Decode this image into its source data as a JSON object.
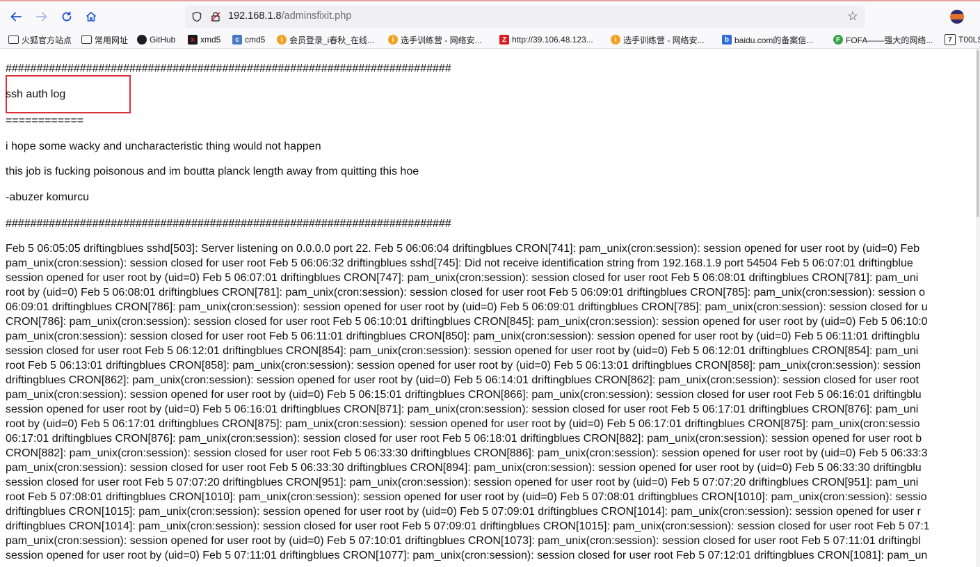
{
  "browser": {
    "url_host": "192.168.1.8",
    "url_path": "/adminsfixit.php"
  },
  "bookmarks": [
    {
      "label": "火狐官方站点",
      "icon": "folder-icon"
    },
    {
      "label": "常用网址",
      "icon": "folder-icon"
    },
    {
      "label": "GitHub",
      "icon": "github-icon"
    },
    {
      "label": "xmd5",
      "icon": "xmd5-icon"
    },
    {
      "label": "cmd5",
      "icon": "cmd5-icon"
    },
    {
      "label": "会员登录_i春秋_在线...",
      "icon": "ichunqiu-icon"
    },
    {
      "label": "选手训练营 - 网络安...",
      "icon": "ichunqiu-icon"
    },
    {
      "label": "http://39.106.48.123...",
      "icon": "z-icon"
    },
    {
      "label": "选手训练营 - 网络安...",
      "icon": "ichunqiu-icon"
    },
    {
      "label": "baidu.com的备案信...",
      "icon": "baidu-icon"
    },
    {
      "label": "FOFA——强大的网络...",
      "icon": "fofa-icon"
    },
    {
      "label": "T00LS",
      "icon": "tools-icon"
    }
  ],
  "page": {
    "hash_line_1": "########################################################################",
    "heading": "ssh auth log",
    "equals_line": "============",
    "message_1": "i hope some wacky and uncharacteristic thing would not happen",
    "message_2": "this job is fucking poisonous and im boutta planck length away from quitting this hoe",
    "signature": "-abuzer komurcu",
    "hash_line_2": "########################################################################",
    "log_lines": [
      "Feb 5 06:05:05 driftingblues sshd[503]: Server listening on 0.0.0.0 port 22. Feb 5 06:06:04 driftingblues CRON[741]: pam_unix(cron:session): session opened for user root by (uid=0) Feb",
      "pam_unix(cron:session): session closed for user root Feb 5 06:06:32 driftingblues sshd[745]: Did not receive identification string from 192.168.1.9 port 54504 Feb 5 06:07:01 driftingblue",
      "session opened for user root by (uid=0) Feb 5 06:07:01 driftingblues CRON[747]: pam_unix(cron:session): session closed for user root Feb 5 06:08:01 driftingblues CRON[781]: pam_uni",
      "root by (uid=0) Feb 5 06:08:01 driftingblues CRON[781]: pam_unix(cron:session): session closed for user root Feb 5 06:09:01 driftingblues CRON[785]: pam_unix(cron:session): session o",
      "06:09:01 driftingblues CRON[786]: pam_unix(cron:session): session opened for user root by (uid=0) Feb 5 06:09:01 driftingblues CRON[785]: pam_unix(cron:session): session closed for u",
      "CRON[786]: pam_unix(cron:session): session closed for user root Feb 5 06:10:01 driftingblues CRON[845]: pam_unix(cron:session): session opened for user root by (uid=0) Feb 5 06:10:0",
      "pam_unix(cron:session): session closed for user root Feb 5 06:11:01 driftingblues CRON[850]: pam_unix(cron:session): session opened for user root by (uid=0) Feb 5 06:11:01 driftingblu",
      "session closed for user root Feb 5 06:12:01 driftingblues CRON[854]: pam_unix(cron:session): session opened for user root by (uid=0) Feb 5 06:12:01 driftingblues CRON[854]: pam_uni",
      "root Feb 5 06:13:01 driftingblues CRON[858]: pam_unix(cron:session): session opened for user root by (uid=0) Feb 5 06:13:01 driftingblues CRON[858]: pam_unix(cron:session): session",
      "driftingblues CRON[862]: pam_unix(cron:session): session opened for user root by (uid=0) Feb 5 06:14:01 driftingblues CRON[862]: pam_unix(cron:session): session closed for user root",
      "pam_unix(cron:session): session opened for user root by (uid=0) Feb 5 06:15:01 driftingblues CRON[866]: pam_unix(cron:session): session closed for user root Feb 5 06:16:01 driftingblu",
      "session opened for user root by (uid=0) Feb 5 06:16:01 driftingblues CRON[871]: pam_unix(cron:session): session closed for user root Feb 5 06:17:01 driftingblues CRON[876]: pam_uni",
      "root by (uid=0) Feb 5 06:17:01 driftingblues CRON[875]: pam_unix(cron:session): session opened for user root by (uid=0) Feb 5 06:17:01 driftingblues CRON[875]: pam_unix(cron:sessio",
      "06:17:01 driftingblues CRON[876]: pam_unix(cron:session): session closed for user root Feb 5 06:18:01 driftingblues CRON[882]: pam_unix(cron:session): session opened for user root b",
      "CRON[882]: pam_unix(cron:session): session closed for user root Feb 5 06:33:30 driftingblues CRON[886]: pam_unix(cron:session): session opened for user root by (uid=0) Feb 5 06:33:3",
      "pam_unix(cron:session): session closed for user root Feb 5 06:33:30 driftingblues CRON[894]: pam_unix(cron:session): session opened for user root by (uid=0) Feb 5 06:33:30 driftingblu",
      "session closed for user root Feb 5 07:07:20 driftingblues CRON[951]: pam_unix(cron:session): session opened for user root by (uid=0) Feb 5 07:07:20 driftingblues CRON[951]: pam_uni",
      "root Feb 5 07:08:01 driftingblues CRON[1010]: pam_unix(cron:session): session opened for user root by (uid=0) Feb 5 07:08:01 driftingblues CRON[1010]: pam_unix(cron:session): sessio",
      "driftingblues CRON[1015]: pam_unix(cron:session): session opened for user root by (uid=0) Feb 5 07:09:01 driftingblues CRON[1014]: pam_unix(cron:session): session opened for user r",
      "driftingblues CRON[1014]: pam_unix(cron:session): session closed for user root Feb 5 07:09:01 driftingblues CRON[1015]: pam_unix(cron:session): session closed for user root Feb 5 07:1",
      "pam_unix(cron:session): session opened for user root by (uid=0) Feb 5 07:10:01 driftingblues CRON[1073]: pam_unix(cron:session): session closed for user root Feb 5 07:11:01 driftingbl",
      "session opened for user root by (uid=0) Feb 5 07:11:01 driftingblues CRON[1077]: pam_unix(cron:session): session closed for user root Feb 5 07:12:01 driftingblues CRON[1081]: pam_un"
    ]
  }
}
